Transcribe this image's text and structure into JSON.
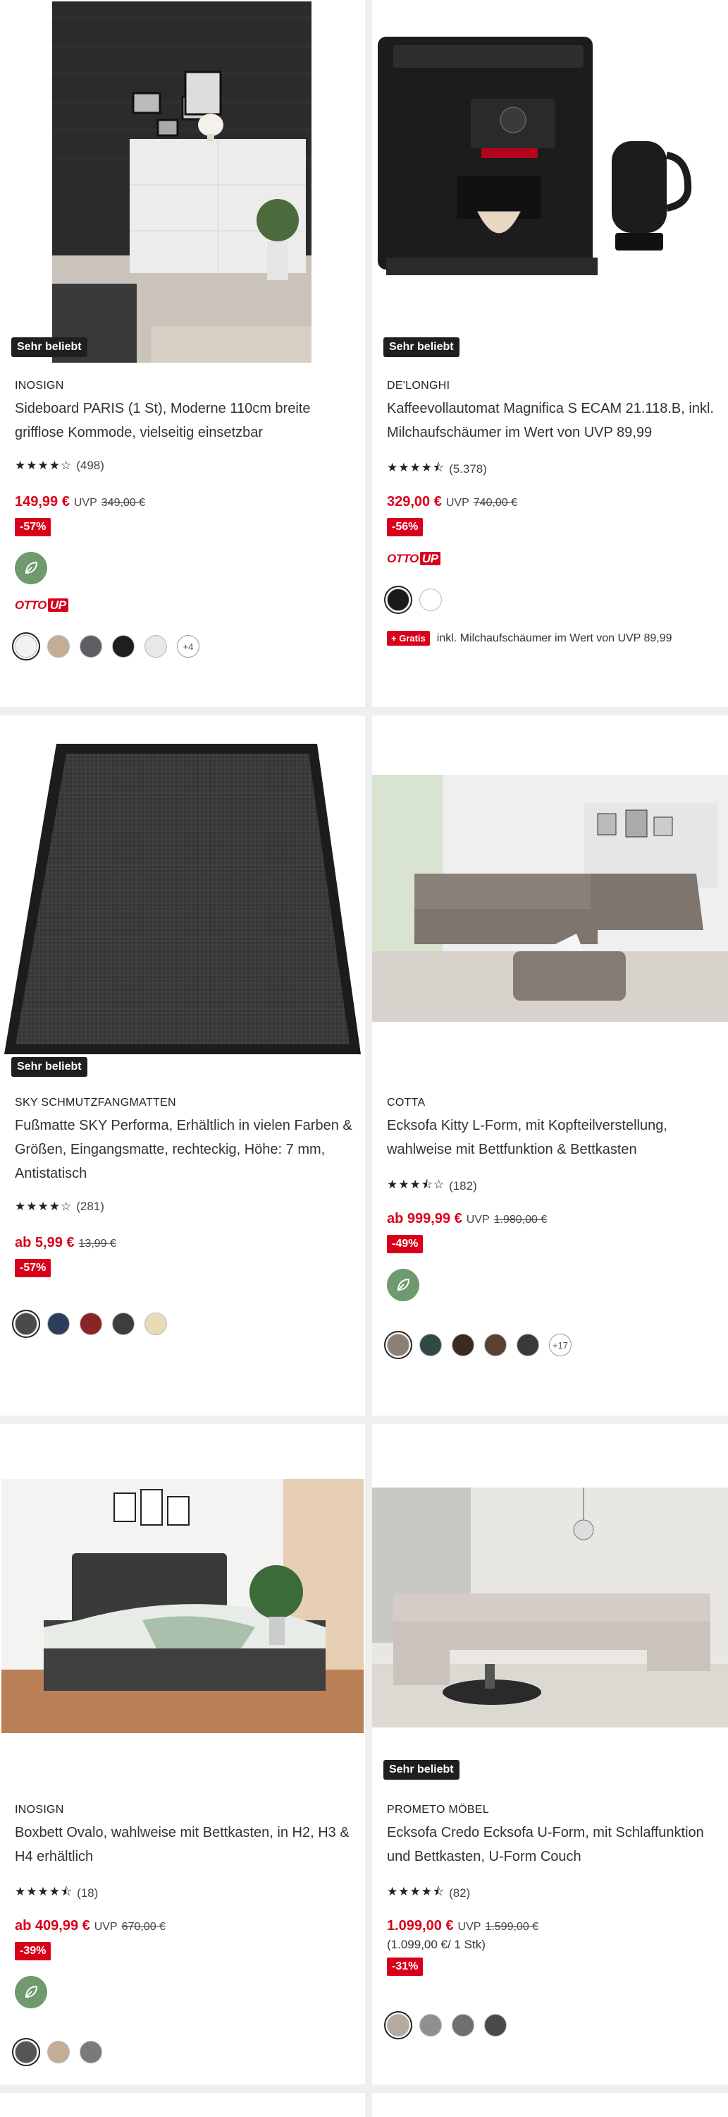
{
  "badge_text": "Sehr beliebt",
  "products": [
    {
      "brand": "INOSIGN",
      "title": "Sideboard PARIS (1 St), Moderne 110cm breite grifflose Kommode, vielseitig einsetzbar",
      "rating_stars": 4,
      "rating_count": "(498)",
      "price": "149,99 €",
      "uvp_label": "UVP",
      "uvp_price": "349,00 €",
      "discount": "-57%",
      "more_colors": "+4",
      "swatch_colors": [
        "#f2f2f2",
        "#c3ad97",
        "#5d5f63",
        "#1e1e1e",
        "#e8e8e8"
      ]
    },
    {
      "brand": "DE'LONGHI",
      "title": "Kaffeevollautomat Magnifica S ECAM 21.118.B, inkl. Milchaufschäumer im Wert von UVP 89,99",
      "rating_stars": 4.5,
      "rating_count": "(5.378)",
      "price": "329,00 €",
      "uvp_label": "UVP",
      "uvp_price": "740,00 €",
      "discount": "-56%",
      "swatch_colors": [
        "#1a1a1a",
        "#ffffff"
      ],
      "gratis_label": "+ Gratis",
      "gratis_text": "inkl. Milchaufschäumer im Wert von UVP 89,99"
    },
    {
      "brand": "SKY SCHMUTZFANGMATTEN",
      "title": "Fußmatte SKY Performa, Erhältlich in vielen Farben & Größen, Eingangsmatte, rechteckig, Höhe: 7 mm, Antistatisch",
      "rating_stars": 4,
      "rating_count": "(281)",
      "price": "ab 5,99 €",
      "uvp_price": "13,99 €",
      "discount": "-57%",
      "swatch_colors": [
        "#4a4a4a",
        "#2c3e5c",
        "#8b2525",
        "#3d3d3d",
        "#eadbb6"
      ]
    },
    {
      "brand": "COTTA",
      "title": "Ecksofa Kitty L-Form, mit Kopfteilverstellung, wahlweise mit Bettfunktion & Bettkasten",
      "rating_stars": 3.5,
      "rating_count": "(182)",
      "price": "ab 999,99 €",
      "uvp_label": "UVP",
      "uvp_price": "1.980,00 €",
      "discount": "-49%",
      "more_colors": "+17",
      "swatch_colors": [
        "#8a8078",
        "#2f4a46",
        "#3b2a22",
        "#5a4030",
        "#3a3a3a"
      ]
    },
    {
      "brand": "INOSIGN",
      "title": "Boxbett Ovalo, wahlweise mit Bettkasten, in H2, H3 & H4 erhältlich",
      "rating_stars": 4.5,
      "rating_count": "(18)",
      "price": "ab 409,99 €",
      "uvp_label": "UVP",
      "uvp_price": "670,00 €",
      "discount": "-39%",
      "swatch_colors": [
        "#555555",
        "#c3ad97",
        "#7a7a7a"
      ]
    },
    {
      "brand": "PROMETO MÖBEL",
      "title": "Ecksofa Credo Ecksofa U-Form, mit Schlaffunktion und Bettkasten, U-Form Couch",
      "rating_stars": 4.5,
      "rating_count": "(82)",
      "price": "1.099,00 €",
      "uvp_label": "UVP",
      "uvp_price": "1.599,00 €",
      "unit_price": "(1.099,00 €/ 1 Stk)",
      "discount": "-31%",
      "swatch_colors": [
        "#b6aa9e",
        "#8f8f8f",
        "#707070",
        "#4a4a48"
      ]
    }
  ],
  "colors": {
    "price_red": "#d8001b",
    "eco_green": "#6f9a6f",
    "badge_bg": "#1f1f1f"
  },
  "icons": [
    "leaf-eco-icon",
    "otto-up-logo",
    "star-icon"
  ]
}
